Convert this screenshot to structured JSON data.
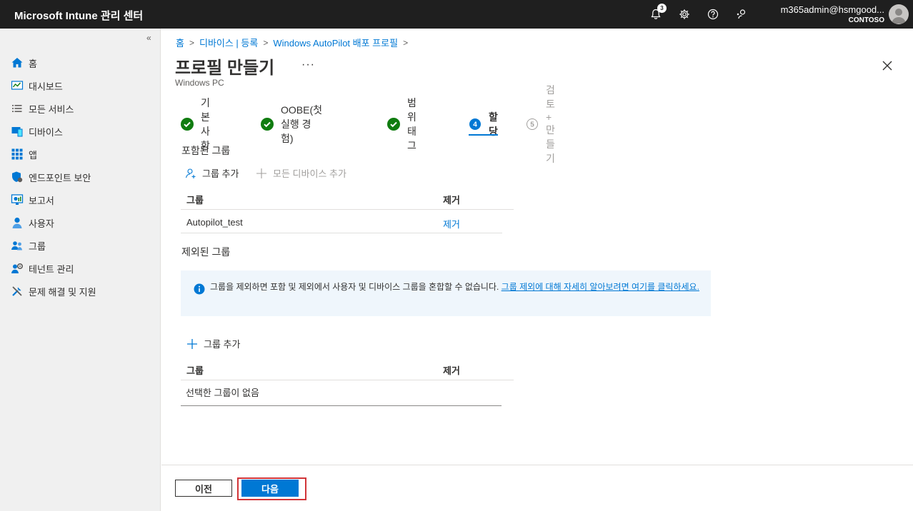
{
  "header": {
    "brand": "Microsoft Intune 관리 센터",
    "notification_count": "3",
    "account_email": "m365admin@hsmgood...",
    "account_tenant": "CONTOSO",
    "icons": [
      "bell-icon",
      "gear-icon",
      "help-icon",
      "feedback-icon",
      "avatar"
    ]
  },
  "sidebar": {
    "collapse_label": "«",
    "items": [
      {
        "label": "홈",
        "icon": "home-icon"
      },
      {
        "label": "대시보드",
        "icon": "dashboard-icon"
      },
      {
        "label": "모든 서비스",
        "icon": "list-icon"
      },
      {
        "label": "디바이스",
        "icon": "devices-icon"
      },
      {
        "label": "앱",
        "icon": "apps-icon"
      },
      {
        "label": "엔드포인트 보안",
        "icon": "shield-icon"
      },
      {
        "label": "보고서",
        "icon": "reports-icon"
      },
      {
        "label": "사용자",
        "icon": "user-icon"
      },
      {
        "label": "그룹",
        "icon": "groups-icon"
      },
      {
        "label": "테넌트 관리",
        "icon": "tenant-icon"
      },
      {
        "label": "문제 해결 및 지원",
        "icon": "tools-icon"
      }
    ]
  },
  "breadcrumb": [
    "홈",
    "디바이스 | 등록",
    "Windows AutoPilot 배포 프로필"
  ],
  "page": {
    "title": "프로필 만들기",
    "ellipsis": "···",
    "subtitle": "Windows PC"
  },
  "steps": [
    {
      "label": "기본 사항",
      "state": "done"
    },
    {
      "label": "OOBE(첫 실행 경험)",
      "state": "done"
    },
    {
      "label": "범위 태그",
      "state": "done"
    },
    {
      "label": "할당",
      "state": "active",
      "number": "4"
    },
    {
      "label": "검토 + 만들기",
      "state": "pending",
      "number": "5"
    }
  ],
  "included": {
    "title": "포함된 그룹",
    "add_group": "그룹 추가",
    "add_all_devices": "모든 디바이스 추가",
    "col_group": "그룹",
    "col_remove": "제거",
    "rows": [
      {
        "group": "Autopilot_test",
        "remove": "제거"
      }
    ]
  },
  "excluded": {
    "title": "제외된 그룹",
    "info_text": "그룹을 제외하면 포함 및 제외에서 사용자 및 디바이스 그룹을 혼합할 수 없습니다. ",
    "info_link": "그룹 제외에 대해 자세히 알아보려면 여기를 클릭하세요.",
    "add_group": "그룹 추가",
    "col_group": "그룹",
    "col_remove": "제거",
    "empty_text": "선택한 그룹이 없음"
  },
  "footer": {
    "prev_label": "이전",
    "next_label": "다음"
  },
  "colors": {
    "accent": "#0078d4",
    "success": "#107c10",
    "highlight": "#d13438",
    "topbar": "#1f1f1f"
  }
}
